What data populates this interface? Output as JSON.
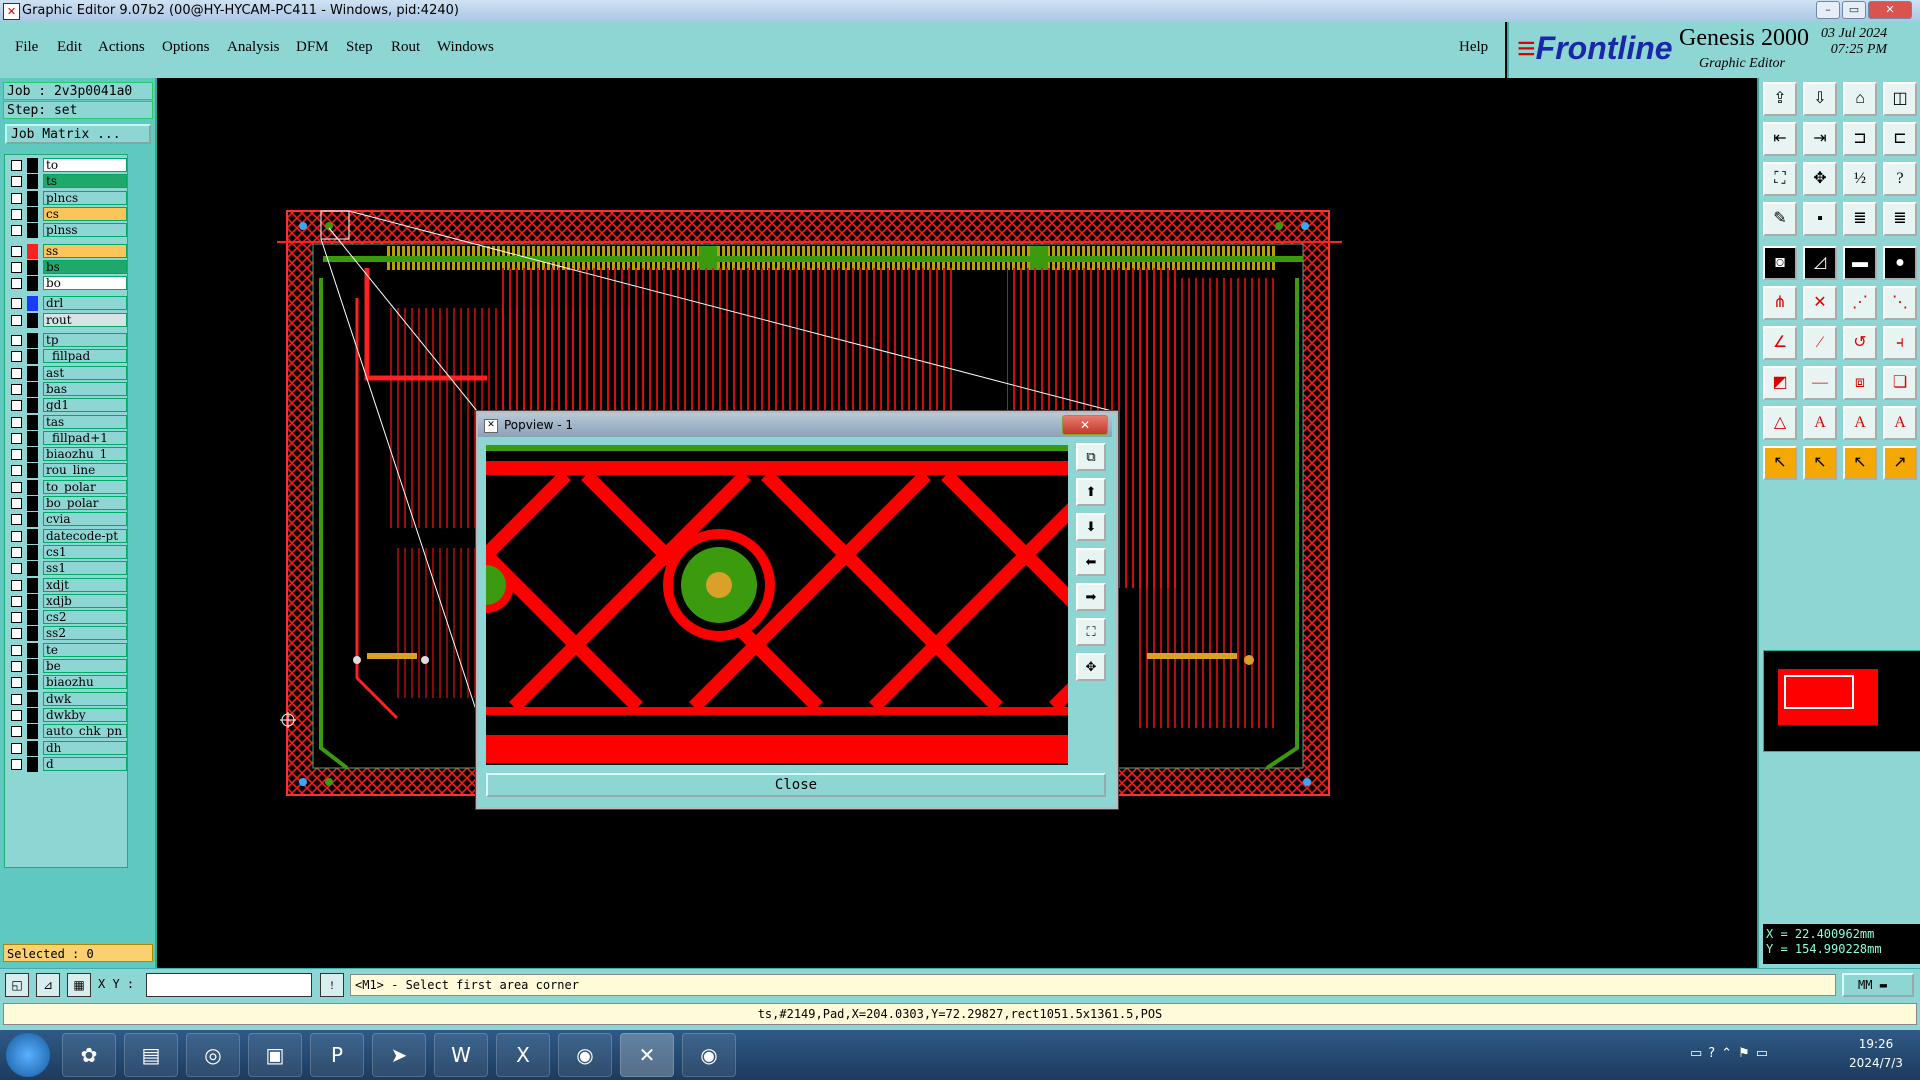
{
  "window": {
    "title": "Graphic Editor 9.07b2 (00@HY-HYCAM-PC411 - Windows, pid:4240)",
    "controls": [
      "–",
      "▭",
      "✕"
    ]
  },
  "menu": {
    "items": [
      "File",
      "Edit",
      "Actions",
      "Options",
      "Analysis",
      "DFM",
      "Step",
      "Rout",
      "Windows"
    ],
    "help": "Help"
  },
  "branding": {
    "frontline": "Frontline",
    "genesis": "Genesis 2000",
    "graphic_editor": "Graphic Editor",
    "date": "03 Jul 2024",
    "time": "07:25 PM"
  },
  "job": {
    "job_label": "Job : 2v3p0041a0",
    "step_label": "Step: set",
    "job_matrix": "Job Matrix ..."
  },
  "layers": [
    {
      "name": "to",
      "color": "#ffffff",
      "swatch": "#000000"
    },
    {
      "name": "ts",
      "color": "#1fa86a",
      "swatch": "#000000"
    },
    {
      "name": "plncs",
      "color": "#8ed6d3",
      "swatch": "#000000"
    },
    {
      "name": "cs",
      "color": "#fbc55a",
      "swatch": "#000000"
    },
    {
      "name": "plnss",
      "color": "#8ed6d3",
      "swatch": "#000000"
    },
    {
      "name": "ss",
      "color": "#fbc55a",
      "swatch": "#ff2020"
    },
    {
      "name": "bs",
      "color": "#1fa86a",
      "swatch": "#000000"
    },
    {
      "name": "bo",
      "color": "#ffffff",
      "swatch": "#000000"
    },
    {
      "name": "drl",
      "color": "#8ed6d3",
      "swatch": "#1a3cff"
    },
    {
      "name": "rout",
      "color": "#d8e4e4",
      "swatch": "#000000"
    },
    {
      "name": "tp",
      "color": "#8ed6d3",
      "swatch": "#000000"
    },
    {
      "name": "_fillpad",
      "color": "#8ed6d3",
      "swatch": "#000000"
    },
    {
      "name": "ast",
      "color": "#8ed6d3",
      "swatch": "#000000"
    },
    {
      "name": "bas",
      "color": "#8ed6d3",
      "swatch": "#000000"
    },
    {
      "name": "gd1",
      "color": "#8ed6d3",
      "swatch": "#000000"
    },
    {
      "name": "tas",
      "color": "#8ed6d3",
      "swatch": "#000000"
    },
    {
      "name": "_fillpad+1",
      "color": "#8ed6d3",
      "swatch": "#000000"
    },
    {
      "name": "biaozhu_1",
      "color": "#8ed6d3",
      "swatch": "#000000"
    },
    {
      "name": "rou_line",
      "color": "#8ed6d3",
      "swatch": "#000000"
    },
    {
      "name": "to_polar",
      "color": "#8ed6d3",
      "swatch": "#000000"
    },
    {
      "name": "bo_polar",
      "color": "#8ed6d3",
      "swatch": "#000000"
    },
    {
      "name": "cvia",
      "color": "#8ed6d3",
      "swatch": "#000000"
    },
    {
      "name": "datecode-pt",
      "color": "#8ed6d3",
      "swatch": "#000000"
    },
    {
      "name": "cs1",
      "color": "#8ed6d3",
      "swatch": "#000000"
    },
    {
      "name": "ss1",
      "color": "#8ed6d3",
      "swatch": "#000000"
    },
    {
      "name": "xdjt",
      "color": "#8ed6d3",
      "swatch": "#000000"
    },
    {
      "name": "xdjb",
      "color": "#8ed6d3",
      "swatch": "#000000"
    },
    {
      "name": "cs2",
      "color": "#8ed6d3",
      "swatch": "#000000"
    },
    {
      "name": "ss2",
      "color": "#8ed6d3",
      "swatch": "#000000"
    },
    {
      "name": "te",
      "color": "#8ed6d3",
      "swatch": "#000000"
    },
    {
      "name": "be",
      "color": "#8ed6d3",
      "swatch": "#000000"
    },
    {
      "name": "biaozhu",
      "color": "#8ed6d3",
      "swatch": "#000000"
    },
    {
      "name": "dwk",
      "color": "#8ed6d3",
      "swatch": "#000000"
    },
    {
      "name": "dwkby",
      "color": "#8ed6d3",
      "swatch": "#000000"
    },
    {
      "name": "auto_chk_pn",
      "color": "#8ed6d3",
      "swatch": "#000000"
    },
    {
      "name": "dh",
      "color": "#8ed6d3",
      "swatch": "#000000"
    },
    {
      "name": "d",
      "color": "#8ed6d3",
      "swatch": "#000000"
    }
  ],
  "selected_label": "Selected : 0",
  "popview": {
    "title": "Popview - 1",
    "close_label": "Close",
    "close_x": "✕"
  },
  "coords": {
    "x": "X = 22.400962mm",
    "y": "Y = 154.990228mm"
  },
  "command": {
    "xy_label": "X Y :",
    "xy_value": "",
    "prompt": "<M1> - Select first area corner",
    "units": "MM"
  },
  "status": "ts,#2149,Pad,X=204.0303,Y=72.29827,rect1051.5x1361.5,POS",
  "taskbar": {
    "time": "19:26",
    "date": "2024/7/3"
  },
  "toolbar_icons": [
    "zoom-home-icon",
    "open-icon",
    "home-icon",
    "layout-icon",
    "pan-left-icon",
    "pan-right-icon",
    "unzoom-icon",
    "split-icon",
    "fit-icon",
    "center-icon",
    "scale-1-2-icon",
    "help-icon",
    "snap-icon",
    "pin-icon",
    "layer-stack-icon",
    "layer-stack-alt-icon",
    "pad-icon",
    "route-icon",
    "ruler-icon",
    "dot-icon",
    "net-icon",
    "cross-icon",
    "connect-icon",
    "link-icon",
    "line-icon",
    "diag-icon",
    "arc-icon",
    "split-line-icon",
    "shape-icon",
    "minus-icon",
    "box-icon",
    "copy-icon",
    "triangle-icon",
    "a-red-icon",
    "a-blue-icon",
    "a-outline-icon",
    "pointer-icon",
    "pointer-box-icon",
    "pointer-move-icon",
    "pointer-path-icon"
  ],
  "colors": {
    "panel": "#8ed6d3",
    "board_red": "#ff0000",
    "pad_green": "#3b9a0e",
    "pad_gold": "#d9a12a"
  }
}
